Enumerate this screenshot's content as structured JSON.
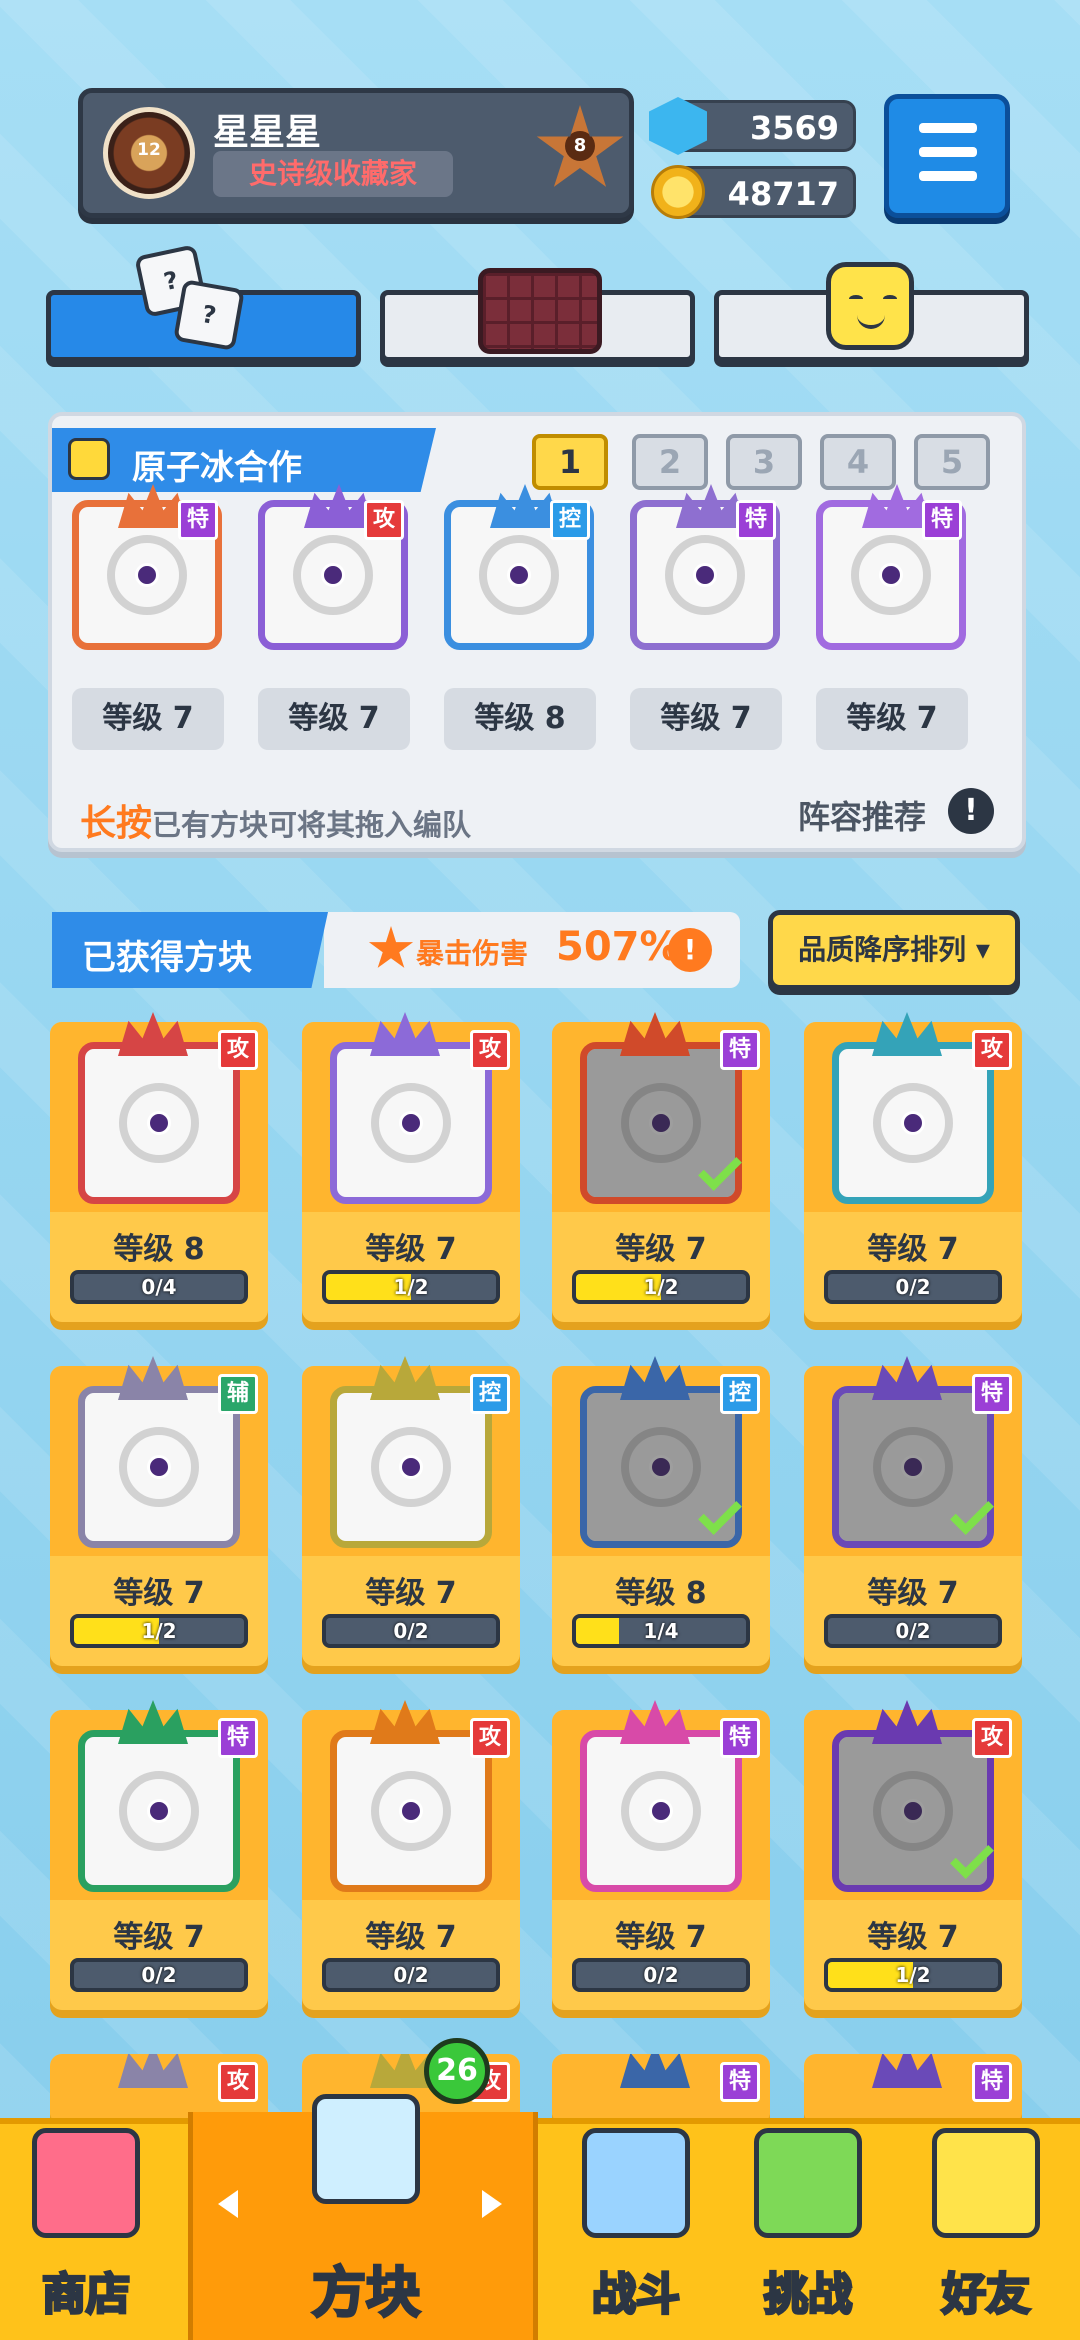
{
  "profile": {
    "name": "星星星",
    "title": "史诗级收藏家",
    "avatar_level": "12",
    "rank": "8"
  },
  "currency": {
    "gems": "3569",
    "coins": "48717"
  },
  "team": {
    "name": "原子冰合作",
    "slots": [
      "1",
      "2",
      "3",
      "4",
      "5"
    ],
    "active_slot": "1",
    "cards": [
      {
        "type": "特",
        "level": "等级 7"
      },
      {
        "type": "攻",
        "level": "等级 7"
      },
      {
        "type": "控",
        "level": "等级 8"
      },
      {
        "type": "特",
        "level": "等级 7"
      },
      {
        "type": "特",
        "level": "等级 7"
      }
    ],
    "hint_emphasis": "长按",
    "hint_text": "已有方块可将其拖入编队",
    "recommend": "阵容推荐"
  },
  "owned": {
    "title": "已获得方块",
    "crit_label": "暴击伤害",
    "crit_value": "507%",
    "sort_label": "品质降序排列 ▾"
  },
  "cards": [
    {
      "type": "攻",
      "level": "等级 8",
      "progress": "0/4",
      "fill": 0,
      "in_team": false
    },
    {
      "type": "攻",
      "level": "等级 7",
      "progress": "1/2",
      "fill": 0.5,
      "in_team": false
    },
    {
      "type": "特",
      "level": "等级 7",
      "progress": "1/2",
      "fill": 0.5,
      "in_team": true
    },
    {
      "type": "攻",
      "level": "等级 7",
      "progress": "0/2",
      "fill": 0,
      "in_team": false
    },
    {
      "type": "辅",
      "level": "等级 7",
      "progress": "1/2",
      "fill": 0.5,
      "in_team": false
    },
    {
      "type": "控",
      "level": "等级 7",
      "progress": "0/2",
      "fill": 0,
      "in_team": false
    },
    {
      "type": "控",
      "level": "等级 8",
      "progress": "1/4",
      "fill": 0.25,
      "in_team": true
    },
    {
      "type": "特",
      "level": "等级 7",
      "progress": "0/2",
      "fill": 0,
      "in_team": true
    },
    {
      "type": "特",
      "level": "等级 7",
      "progress": "0/2",
      "fill": 0,
      "in_team": false
    },
    {
      "type": "攻",
      "level": "等级 7",
      "progress": "0/2",
      "fill": 0,
      "in_team": false
    },
    {
      "type": "特",
      "level": "等级 7",
      "progress": "0/2",
      "fill": 0,
      "in_team": false
    },
    {
      "type": "攻",
      "level": "等级 7",
      "progress": "1/2",
      "fill": 0.5,
      "in_team": true
    }
  ],
  "partial_cards": [
    {
      "type": "攻"
    },
    {
      "type": "攻"
    },
    {
      "type": "特"
    },
    {
      "type": "特"
    }
  ],
  "nav": {
    "shop": "商店",
    "blocks": "方块",
    "battle": "战斗",
    "challenge": "挑战",
    "friends": "好友",
    "blocks_badge": "26"
  },
  "colors": {
    "attack": "#e53a3a",
    "special": "#9b3fd6",
    "control": "#2b9be8",
    "support": "#2aa66a",
    "accent": "#2f8ce8"
  }
}
